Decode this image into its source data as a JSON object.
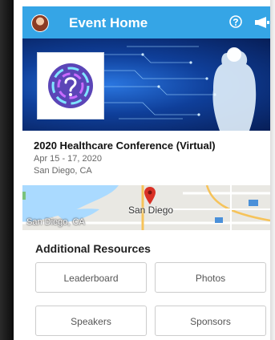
{
  "header": {
    "title": "Event Home",
    "accent_color": "#35a5e6",
    "help_icon": "help-circle-icon",
    "announce_icon": "megaphone-icon"
  },
  "event": {
    "name": "2020 Healthcare Conference (Virtual)",
    "dates": "Apr 15 - 17, 2020",
    "location": "San Diego, CA"
  },
  "map": {
    "city_label": "San Diego",
    "area_label": "San Diego, CA",
    "pin_color": "#d93025"
  },
  "resources": {
    "title": "Additional Resources",
    "buttons": [
      "Leaderboard",
      "Photos",
      "Speakers",
      "Sponsors"
    ]
  }
}
